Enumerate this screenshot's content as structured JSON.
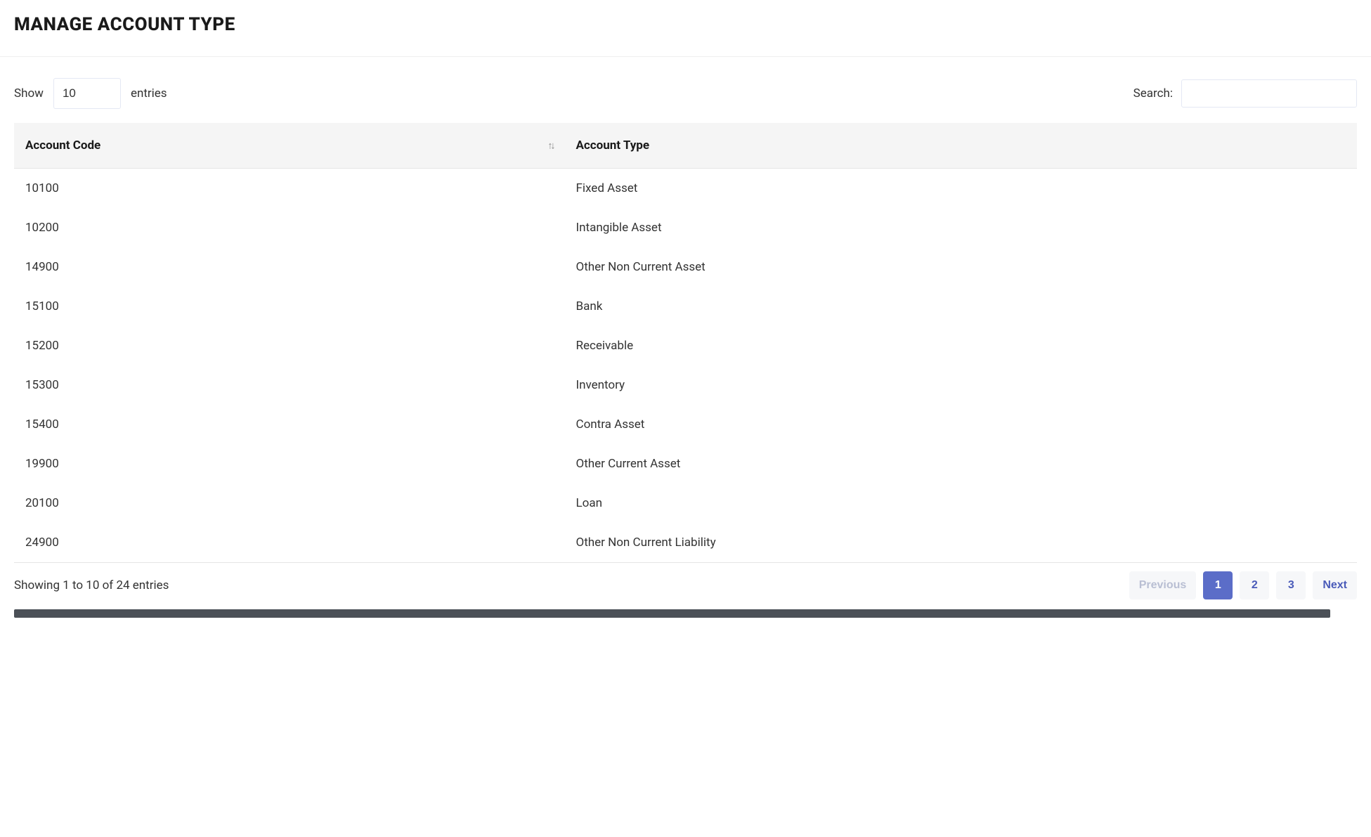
{
  "page": {
    "title": "MANAGE ACCOUNT TYPE"
  },
  "controls": {
    "show_label": "Show",
    "entries_label": "entries",
    "length_value": "10",
    "search_label": "Search:",
    "search_value": ""
  },
  "table": {
    "columns": [
      {
        "label": "Account Code",
        "sortable": true
      },
      {
        "label": "Account Type",
        "sortable": false
      }
    ],
    "rows": [
      {
        "code": "10100",
        "type": "Fixed Asset"
      },
      {
        "code": "10200",
        "type": "Intangible Asset"
      },
      {
        "code": "14900",
        "type": "Other Non Current Asset"
      },
      {
        "code": "15100",
        "type": "Bank"
      },
      {
        "code": "15200",
        "type": "Receivable"
      },
      {
        "code": "15300",
        "type": "Inventory"
      },
      {
        "code": "15400",
        "type": "Contra Asset"
      },
      {
        "code": "19900",
        "type": "Other Current Asset"
      },
      {
        "code": "20100",
        "type": "Loan"
      },
      {
        "code": "24900",
        "type": "Other Non Current Liability"
      }
    ]
  },
  "footer": {
    "info": "Showing 1 to 10 of 24 entries",
    "pagination": {
      "previous_label": "Previous",
      "next_label": "Next",
      "pages": [
        "1",
        "2",
        "3"
      ],
      "active": "1",
      "previous_disabled": true,
      "next_disabled": false
    }
  }
}
